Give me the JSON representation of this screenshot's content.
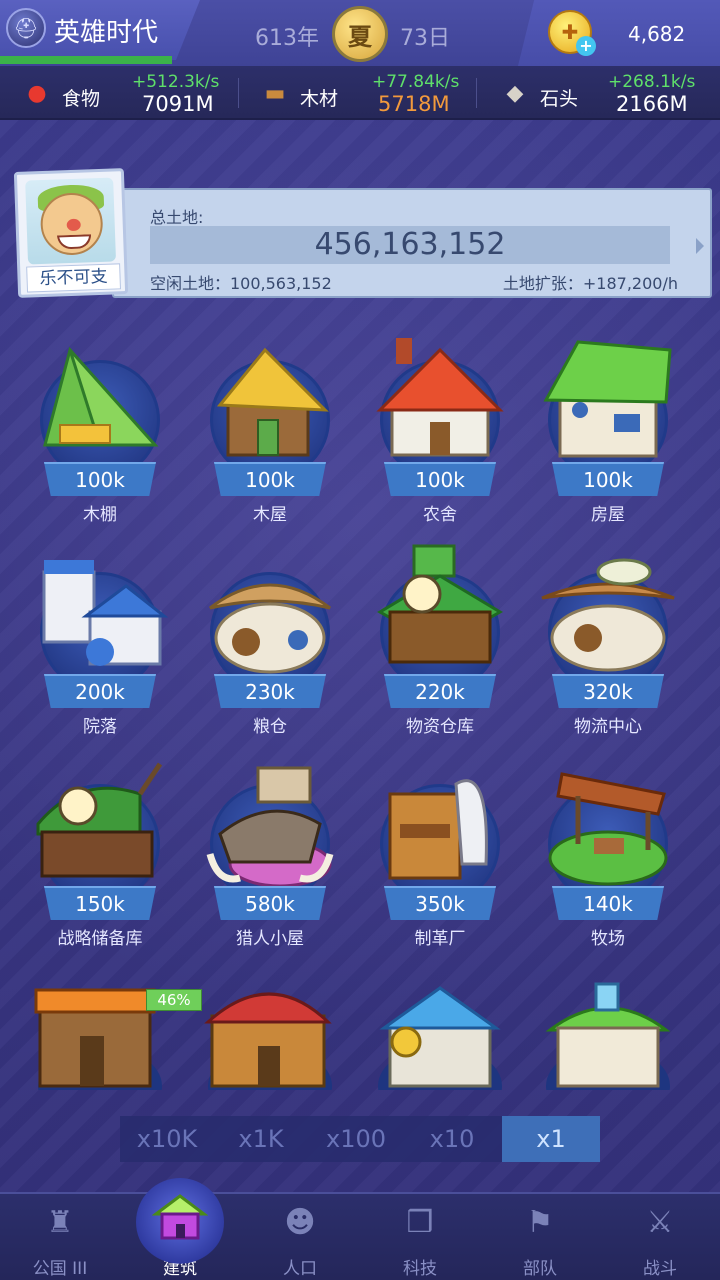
{
  "header": {
    "kingdom_name": "英雄时代",
    "year": "613年",
    "season": "夏",
    "day": "73日",
    "coins": "4,682"
  },
  "resources": [
    {
      "name": "食物",
      "rate": "+512.3k/s",
      "total": "7091M",
      "icon": "apple-icon"
    },
    {
      "name": "木材",
      "rate": "+77.84k/s",
      "total": "5718M",
      "icon": "wood-icon"
    },
    {
      "name": "石头",
      "rate": "+268.1k/s",
      "total": "2166M",
      "icon": "stone-icon"
    }
  ],
  "land": {
    "avatar_name": "乐不可支",
    "total_label": "总土地:",
    "total_value": "456,163,152",
    "idle_text": "空闲土地：100,563,152",
    "expand_text": "土地扩张：+187,200/h"
  },
  "buildings": [
    {
      "name": "木棚",
      "cost": "100k"
    },
    {
      "name": "木屋",
      "cost": "100k"
    },
    {
      "name": "农舍",
      "cost": "100k"
    },
    {
      "name": "房屋",
      "cost": "100k"
    },
    {
      "name": "院落",
      "cost": "200k"
    },
    {
      "name": "粮仓",
      "cost": "230k"
    },
    {
      "name": "物资仓库",
      "cost": "220k"
    },
    {
      "name": "物流中心",
      "cost": "320k"
    },
    {
      "name": "战略储备库",
      "cost": "150k"
    },
    {
      "name": "猎人小屋",
      "cost": "580k"
    },
    {
      "name": "制革厂",
      "cost": "350k"
    },
    {
      "name": "牧场",
      "cost": "140k"
    }
  ],
  "progress_tag": "46%",
  "multipliers": [
    "x10K",
    "x1K",
    "x100",
    "x10",
    "x1"
  ],
  "active_multiplier": "x1",
  "nav": [
    {
      "label": "公国 III",
      "icon": "castle-icon"
    },
    {
      "label": "建筑",
      "icon": "house-icon"
    },
    {
      "label": "人口",
      "icon": "person-icon"
    },
    {
      "label": "科技",
      "icon": "book-icon"
    },
    {
      "label": "部队",
      "icon": "banner-icon"
    },
    {
      "label": "战斗",
      "icon": "crossed-swords-icon"
    }
  ],
  "active_nav": "建筑"
}
